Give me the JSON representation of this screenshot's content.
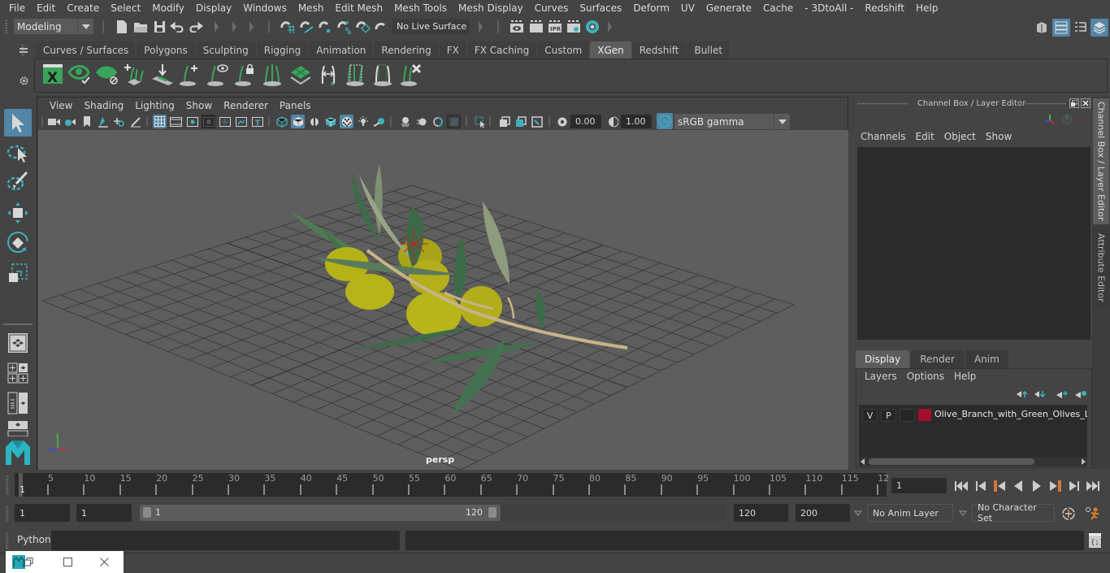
{
  "menubar": {
    "items": [
      "File",
      "Edit",
      "Create",
      "Select",
      "Modify",
      "Display",
      "Windows",
      "Mesh",
      "Edit Mesh",
      "Mesh Tools",
      "Mesh Display",
      "Curves",
      "Surfaces",
      "Deform",
      "UV",
      "Generate",
      "Cache",
      "- 3DtoAll -",
      "Redshift",
      "Help"
    ]
  },
  "statusline": {
    "workspace": "Modeling",
    "live_surface": "No Live Surface",
    "icons": [
      "new-scene-icon",
      "open-scene-icon",
      "save-scene-icon",
      "undo-icon",
      "redo-icon",
      "snap-grid-icon",
      "snap-curve-icon",
      "snap-point-icon",
      "snap-view-plane-icon",
      "snap-surface-icon",
      "make-live-icon",
      "render-view-icon",
      "render-current-icon",
      "ipr-render-icon",
      "render-settings-icon",
      "hypershade-icon"
    ],
    "right_icons": [
      "modeling-toolkit-icon",
      "attribute-editor-toggle-icon",
      "tool-settings-toggle-icon",
      "channel-box-toggle-icon"
    ]
  },
  "shelf": {
    "tabs": [
      "Curves / Surfaces",
      "Polygons",
      "Sculpting",
      "Rigging",
      "Animation",
      "Rendering",
      "FX",
      "FX Caching",
      "Custom",
      "XGen",
      "Redshift",
      "Bullet"
    ],
    "active_tab": "XGen",
    "icons": [
      "xgen-editor-icon",
      "xgen-preview-icon",
      "xgen-hide-icon",
      "xgen-add-guides-icon",
      "xgen-place-guides-icon",
      "xgen-add-guide-icon",
      "xgen-guide-visibility-icon",
      "xgen-lock-guide-icon",
      "xgen-split-guides-icon",
      "xgen-density-icon",
      "xgen-flip-guides-icon",
      "xgen-select-guides-icon",
      "xgen-bound-guides-icon",
      "xgen-delete-guides-icon"
    ]
  },
  "toolbox": {
    "tools": [
      "select-tool-icon",
      "lasso-tool-icon",
      "paint-select-tool-icon",
      "move-tool-icon",
      "rotate-tool-icon",
      "scale-tool-icon"
    ],
    "layouts": [
      "single-pane-layout-icon",
      "four-pane-layout-icon",
      "side-by-side-layout-icon",
      "stacked-layout-icon"
    ]
  },
  "viewport": {
    "menu": [
      "View",
      "Shading",
      "Lighting",
      "Show",
      "Renderer",
      "Panels"
    ],
    "exposure": "0.00",
    "gamma": "1.00",
    "color_management": "ON",
    "color_space": "sRGB gamma",
    "camera": "persp",
    "axis": {
      "x": "x",
      "y": "y",
      "z": "z"
    }
  },
  "channel_box": {
    "title": "Channel Box / Layer Editor",
    "menu": [
      "Channels",
      "Edit",
      "Object",
      "Show"
    ]
  },
  "layer_editor": {
    "tabs": [
      "Display",
      "Render",
      "Anim"
    ],
    "active_tab": "Display",
    "menu": [
      "Layers",
      "Options",
      "Help"
    ],
    "layers": [
      {
        "visible": "V",
        "playback": "P",
        "type": "",
        "color": "#a01030",
        "name": "Olive_Branch_with_Green_Olives_Lyin"
      }
    ]
  },
  "side_tabs": [
    "Channel Box / Layer Editor",
    "Attribute Editor"
  ],
  "timeline": {
    "start_label": "1",
    "ticks": [
      "5",
      "10",
      "15",
      "20",
      "25",
      "30",
      "35",
      "40",
      "45",
      "50",
      "55",
      "60",
      "65",
      "70",
      "75",
      "80",
      "85",
      "90",
      "95",
      "100",
      "105",
      "110",
      "115",
      "12"
    ],
    "current_frame": "1"
  },
  "range": {
    "start": "1",
    "anim_start": "1",
    "slider_min": "1",
    "slider_max": "120",
    "anim_end": "120",
    "end": "200",
    "anim_layer": "No Anim Layer",
    "character_set": "No Character Set"
  },
  "command_line": {
    "language": "Python",
    "input": "",
    "result": ""
  }
}
